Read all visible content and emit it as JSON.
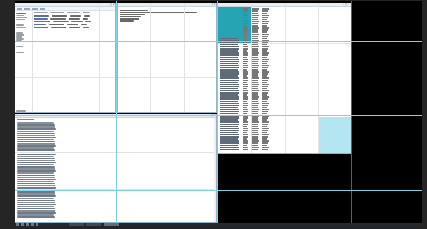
{
  "explorer": {
    "title": "",
    "ribbon_tabs": [
      "",
      "",
      "",
      ""
    ],
    "nav_items": [
      "",
      "",
      "",
      "",
      "",
      "",
      "",
      "",
      "",
      "",
      "",
      "",
      "",
      ""
    ],
    "files": [
      {
        "name": "",
        "date": "",
        "type": "",
        "size": ""
      },
      {
        "name": "",
        "date": "",
        "type": "",
        "size": ""
      },
      {
        "name": "",
        "date": "",
        "type": "",
        "size": ""
      },
      {
        "name": "",
        "date": "",
        "type": "",
        "size": ""
      },
      {
        "name": "",
        "date": "",
        "type": "",
        "size": ""
      }
    ],
    "status": ""
  },
  "notepad": {
    "title": "",
    "lines": [
      "",
      "",
      "",
      "",
      "",
      ""
    ]
  },
  "spreadsheet": {
    "title": "",
    "header_color": "#26a4b4",
    "selection_color": "#b3e6f0"
  },
  "lower_panel": {
    "title": "",
    "header": ""
  },
  "taskbar": {
    "apps": [
      "",
      "",
      ""
    ],
    "tray_time": ""
  },
  "accent_color": "#7fd2e6"
}
